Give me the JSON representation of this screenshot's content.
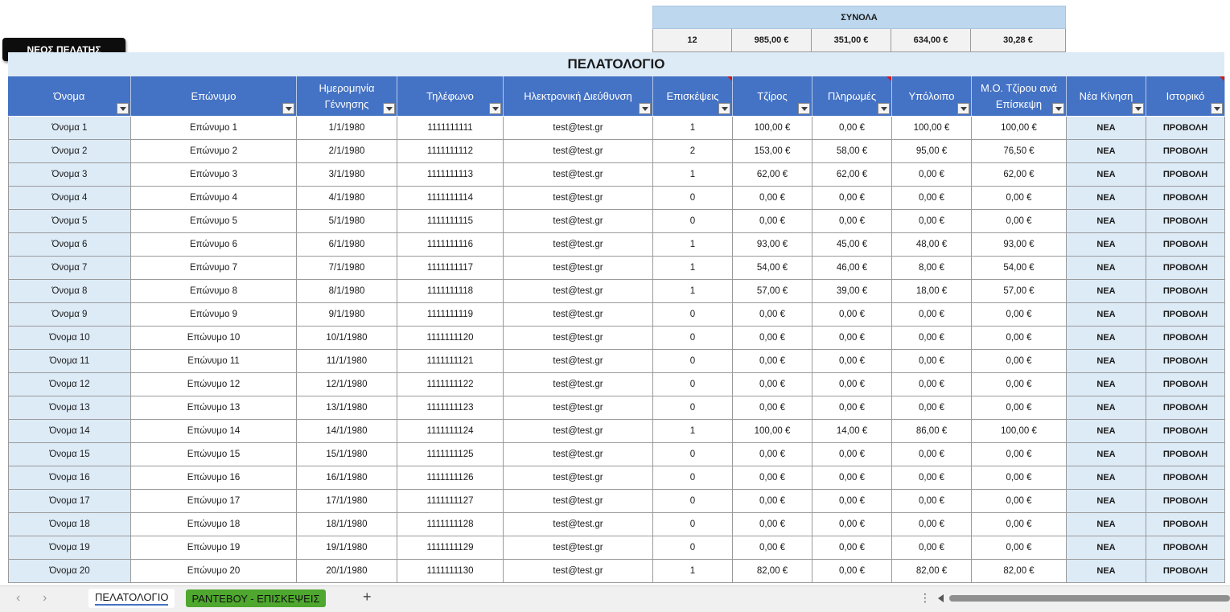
{
  "totals": {
    "title": "ΣΥΝΟΛΑ",
    "values": [
      "12",
      "985,00 €",
      "351,00 €",
      "634,00 €",
      "30,28 €"
    ]
  },
  "new_client_button": "ΝΕΟΣ ΠΕΛΑΤΗΣ",
  "sheet_title": "ΠΕΛΑΤΟΛΟΓΙΟ",
  "columns": [
    "Όνομα",
    "Επώνυμο",
    "Ημερομηνία Γέννησης",
    "Τηλέφωνο",
    "Ηλεκτρονική Διεύθυνση",
    "Επισκέψεις",
    "Τζίρος",
    "Πληρωμές",
    "Υπόλοιπο",
    "Μ.Ο. Τζίρου ανά Επίσκεψη",
    "Νέα Κίνηση",
    "Ιστορικό"
  ],
  "rows": [
    [
      "Όνομα 1",
      "Επώνυμο 1",
      "1/1/1980",
      "1111111111",
      "test@test.gr",
      "1",
      "100,00 €",
      "0,00 €",
      "100,00 €",
      "100,00 €",
      "ΝΕΑ",
      "ΠΡΟΒΟΛΗ"
    ],
    [
      "Όνομα 2",
      "Επώνυμο 2",
      "2/1/1980",
      "1111111112",
      "test@test.gr",
      "2",
      "153,00 €",
      "58,00 €",
      "95,00 €",
      "76,50 €",
      "ΝΕΑ",
      "ΠΡΟΒΟΛΗ"
    ],
    [
      "Όνομα 3",
      "Επώνυμο 3",
      "3/1/1980",
      "1111111113",
      "test@test.gr",
      "1",
      "62,00 €",
      "62,00 €",
      "0,00 €",
      "62,00 €",
      "ΝΕΑ",
      "ΠΡΟΒΟΛΗ"
    ],
    [
      "Όνομα 4",
      "Επώνυμο 4",
      "4/1/1980",
      "1111111114",
      "test@test.gr",
      "0",
      "0,00 €",
      "0,00 €",
      "0,00 €",
      "0,00 €",
      "ΝΕΑ",
      "ΠΡΟΒΟΛΗ"
    ],
    [
      "Όνομα 5",
      "Επώνυμο 5",
      "5/1/1980",
      "1111111115",
      "test@test.gr",
      "0",
      "0,00 €",
      "0,00 €",
      "0,00 €",
      "0,00 €",
      "ΝΕΑ",
      "ΠΡΟΒΟΛΗ"
    ],
    [
      "Όνομα 6",
      "Επώνυμο 6",
      "6/1/1980",
      "1111111116",
      "test@test.gr",
      "1",
      "93,00 €",
      "45,00 €",
      "48,00 €",
      "93,00 €",
      "ΝΕΑ",
      "ΠΡΟΒΟΛΗ"
    ],
    [
      "Όνομα 7",
      "Επώνυμο 7",
      "7/1/1980",
      "1111111117",
      "test@test.gr",
      "1",
      "54,00 €",
      "46,00 €",
      "8,00 €",
      "54,00 €",
      "ΝΕΑ",
      "ΠΡΟΒΟΛΗ"
    ],
    [
      "Όνομα 8",
      "Επώνυμο 8",
      "8/1/1980",
      "1111111118",
      "test@test.gr",
      "1",
      "57,00 €",
      "39,00 €",
      "18,00 €",
      "57,00 €",
      "ΝΕΑ",
      "ΠΡΟΒΟΛΗ"
    ],
    [
      "Όνομα 9",
      "Επώνυμο 9",
      "9/1/1980",
      "1111111119",
      "test@test.gr",
      "0",
      "0,00 €",
      "0,00 €",
      "0,00 €",
      "0,00 €",
      "ΝΕΑ",
      "ΠΡΟΒΟΛΗ"
    ],
    [
      "Όνομα 10",
      "Επώνυμο 10",
      "10/1/1980",
      "1111111120",
      "test@test.gr",
      "0",
      "0,00 €",
      "0,00 €",
      "0,00 €",
      "0,00 €",
      "ΝΕΑ",
      "ΠΡΟΒΟΛΗ"
    ],
    [
      "Όνομα 11",
      "Επώνυμο 11",
      "11/1/1980",
      "1111111121",
      "test@test.gr",
      "0",
      "0,00 €",
      "0,00 €",
      "0,00 €",
      "0,00 €",
      "ΝΕΑ",
      "ΠΡΟΒΟΛΗ"
    ],
    [
      "Όνομα 12",
      "Επώνυμο 12",
      "12/1/1980",
      "1111111122",
      "test@test.gr",
      "0",
      "0,00 €",
      "0,00 €",
      "0,00 €",
      "0,00 €",
      "ΝΕΑ",
      "ΠΡΟΒΟΛΗ"
    ],
    [
      "Όνομα 13",
      "Επώνυμο 13",
      "13/1/1980",
      "1111111123",
      "test@test.gr",
      "0",
      "0,00 €",
      "0,00 €",
      "0,00 €",
      "0,00 €",
      "ΝΕΑ",
      "ΠΡΟΒΟΛΗ"
    ],
    [
      "Όνομα 14",
      "Επώνυμο 14",
      "14/1/1980",
      "1111111124",
      "test@test.gr",
      "1",
      "100,00 €",
      "14,00 €",
      "86,00 €",
      "100,00 €",
      "ΝΕΑ",
      "ΠΡΟΒΟΛΗ"
    ],
    [
      "Όνομα 15",
      "Επώνυμο 15",
      "15/1/1980",
      "1111111125",
      "test@test.gr",
      "0",
      "0,00 €",
      "0,00 €",
      "0,00 €",
      "0,00 €",
      "ΝΕΑ",
      "ΠΡΟΒΟΛΗ"
    ],
    [
      "Όνομα 16",
      "Επώνυμο 16",
      "16/1/1980",
      "1111111126",
      "test@test.gr",
      "0",
      "0,00 €",
      "0,00 €",
      "0,00 €",
      "0,00 €",
      "ΝΕΑ",
      "ΠΡΟΒΟΛΗ"
    ],
    [
      "Όνομα 17",
      "Επώνυμο 17",
      "17/1/1980",
      "1111111127",
      "test@test.gr",
      "0",
      "0,00 €",
      "0,00 €",
      "0,00 €",
      "0,00 €",
      "ΝΕΑ",
      "ΠΡΟΒΟΛΗ"
    ],
    [
      "Όνομα 18",
      "Επώνυμο 18",
      "18/1/1980",
      "1111111128",
      "test@test.gr",
      "0",
      "0,00 €",
      "0,00 €",
      "0,00 €",
      "0,00 €",
      "ΝΕΑ",
      "ΠΡΟΒΟΛΗ"
    ],
    [
      "Όνομα 19",
      "Επώνυμο 19",
      "19/1/1980",
      "1111111129",
      "test@test.gr",
      "0",
      "0,00 €",
      "0,00 €",
      "0,00 €",
      "0,00 €",
      "ΝΕΑ",
      "ΠΡΟΒΟΛΗ"
    ],
    [
      "Όνομα 20",
      "Επώνυμο 20",
      "20/1/1980",
      "1111111130",
      "test@test.gr",
      "1",
      "82,00 €",
      "0,00 €",
      "82,00 €",
      "82,00 €",
      "ΝΕΑ",
      "ΠΡΟΒΟΛΗ"
    ]
  ],
  "tabs": {
    "active": "ΠΕΛΑΤΟΛΟΓΙΟ",
    "other": "ΡΑΝΤΕΒΟΥ - ΕΠΙΣΚΕΨΕΙΣ",
    "add_icon": "plus-icon",
    "prev_icon": "chevron-left-icon",
    "next_icon": "chevron-right-icon",
    "more_icon": "more-vertical-icon"
  },
  "colors": {
    "header_bg": "#4472c4",
    "name_col_bg": "#ddebf7",
    "totals_title_bg": "#bdd7ee",
    "tab_green": "#4ea72e",
    "comment_marker": "#d11a1a"
  }
}
